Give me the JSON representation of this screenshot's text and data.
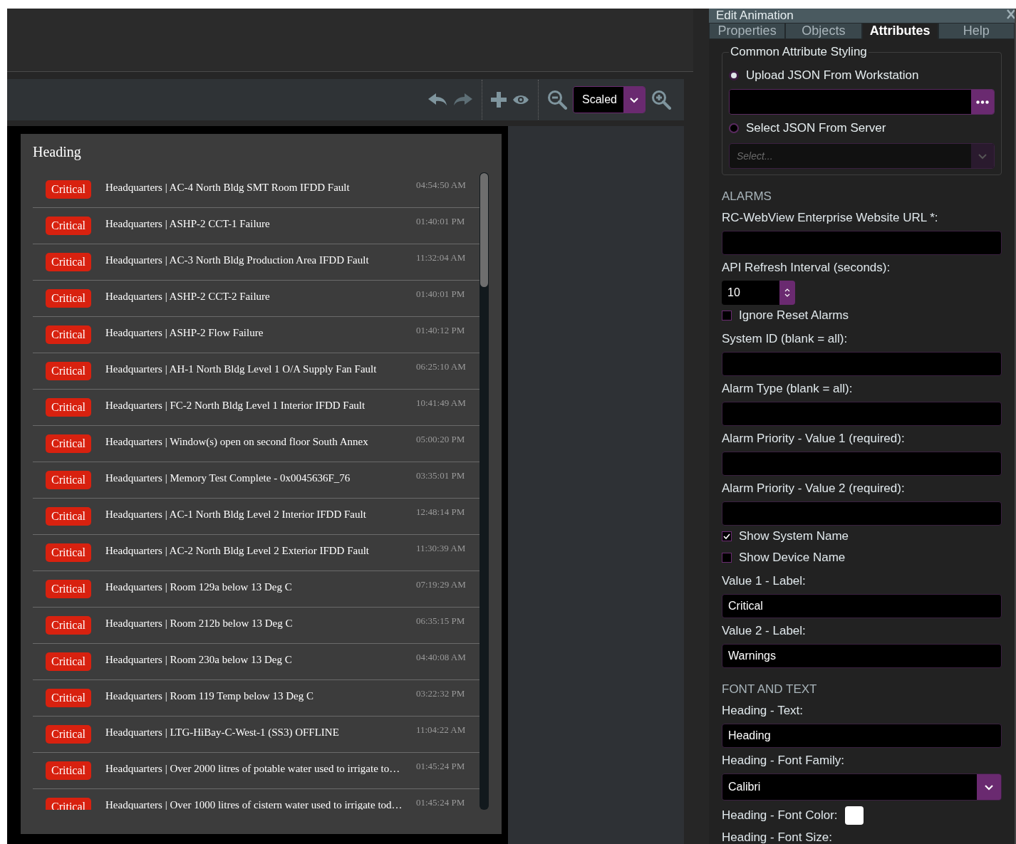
{
  "toolbar": {
    "zoom_mode": "Scaled"
  },
  "alarm_widget": {
    "heading": "Heading",
    "alarms": [
      {
        "priority": "Critical",
        "message": "Headquarters | AC-4 North Bldg SMT Room IFDD Fault",
        "time": "04:54:50 AM"
      },
      {
        "priority": "Critical",
        "message": "Headquarters | ASHP-2 CCT-1 Failure",
        "time": "01:40:01 PM"
      },
      {
        "priority": "Critical",
        "message": "Headquarters | AC-3 North Bldg Production Area IFDD Fault",
        "time": "11:32:04 AM"
      },
      {
        "priority": "Critical",
        "message": "Headquarters | ASHP-2 CCT-2 Failure",
        "time": "01:40:01 PM"
      },
      {
        "priority": "Critical",
        "message": "Headquarters | ASHP-2 Flow Failure",
        "time": "01:40:12 PM"
      },
      {
        "priority": "Critical",
        "message": "Headquarters | AH-1 North Bldg Level 1 O/A Supply Fan Fault",
        "time": "06:25:10 AM"
      },
      {
        "priority": "Critical",
        "message": "Headquarters | FC-2 North Bldg Level 1 Interior IFDD Fault",
        "time": "10:41:49 AM"
      },
      {
        "priority": "Critical",
        "message": "Headquarters | Window(s) open on second floor South Annex",
        "time": "05:00:20 PM"
      },
      {
        "priority": "Critical",
        "message": "Headquarters | Memory Test Complete - 0x0045636F_76",
        "time": "03:35:01 PM"
      },
      {
        "priority": "Critical",
        "message": "Headquarters | AC-1 North Bldg Level 2 Interior IFDD Fault",
        "time": "12:48:14 PM"
      },
      {
        "priority": "Critical",
        "message": "Headquarters | AC-2 North Bldg Level 2 Exterior IFDD Fault",
        "time": "11:30:39 AM"
      },
      {
        "priority": "Critical",
        "message": "Headquarters | Room 129a below 13 Deg C",
        "time": "07:19:29 AM"
      },
      {
        "priority": "Critical",
        "message": "Headquarters | Room 212b below 13 Deg C",
        "time": "06:35:15 PM"
      },
      {
        "priority": "Critical",
        "message": "Headquarters | Room 230a below 13 Deg C",
        "time": "04:40:08 AM"
      },
      {
        "priority": "Critical",
        "message": "Headquarters | Room 119 Temp below 13 Deg C",
        "time": "03:22:32 PM"
      },
      {
        "priority": "Critical",
        "message": "Headquarters | LTG-HiBay-C-West-1 (SS3) OFFLINE",
        "time": "11:04:22 AM"
      },
      {
        "priority": "Critical",
        "message": "Headquarters | Over 2000 litres of potable water used to irrigate to…",
        "time": "01:45:24 PM"
      },
      {
        "priority": "Critical",
        "message": "Headquarters | Over 1000 litres of cistern water used to irrigate tod…",
        "time": "01:45:24 PM"
      }
    ]
  },
  "panel": {
    "title": "Edit Animation",
    "tabs": [
      {
        "label": "Properties",
        "selected": false
      },
      {
        "label": "Objects",
        "selected": false
      },
      {
        "label": "Attributes",
        "selected": true
      },
      {
        "label": "Help",
        "selected": false
      }
    ],
    "fieldset": {
      "legend": "Common Attribute Styling",
      "options": [
        {
          "label": "Upload JSON From Workstation",
          "selected": true
        },
        {
          "label": "Select JSON From Server",
          "selected": false
        }
      ],
      "server_select": {
        "placeholder": "Select..."
      }
    },
    "items": [
      {
        "kind": "heading",
        "text": "ALARMS"
      },
      {
        "kind": "label",
        "text": "RC-WebView Enterprise Website URL *:"
      },
      {
        "kind": "field"
      },
      {
        "kind": "label",
        "text": "API Refresh Interval (seconds):"
      },
      {
        "kind": "number",
        "value": "10"
      },
      {
        "kind": "checkbox",
        "text": "Ignore Reset Alarms",
        "checked": false
      },
      {
        "kind": "label",
        "text": "System ID (blank = all):"
      },
      {
        "kind": "field"
      },
      {
        "kind": "label",
        "text": "Alarm Type (blank = all):"
      },
      {
        "kind": "field"
      },
      {
        "kind": "label",
        "text": "Alarm Priority - Value 1 (required):"
      },
      {
        "kind": "field"
      },
      {
        "kind": "label",
        "text": "Alarm Priority - Value 2 (required):"
      },
      {
        "kind": "field"
      },
      {
        "kind": "checkbox",
        "text": "Show System Name",
        "checked": true
      },
      {
        "kind": "checkbox",
        "text": "Show Device Name",
        "checked": false
      },
      {
        "kind": "label",
        "text": "Value 1 - Label:"
      },
      {
        "kind": "field",
        "value": "Critical"
      },
      {
        "kind": "label",
        "text": "Value 2 - Label:"
      },
      {
        "kind": "field",
        "value": "Warnings"
      },
      {
        "kind": "heading",
        "text": "FONT AND TEXT"
      },
      {
        "kind": "label",
        "text": "Heading - Text:"
      },
      {
        "kind": "field",
        "value": "Heading"
      },
      {
        "kind": "label",
        "text": "Heading - Font Family:"
      },
      {
        "kind": "select",
        "value": "Calibri"
      },
      {
        "kind": "color",
        "text": "Heading - Font Color:",
        "color": "#ffffff"
      },
      {
        "kind": "label",
        "text": "Heading - Font Size:"
      }
    ]
  }
}
